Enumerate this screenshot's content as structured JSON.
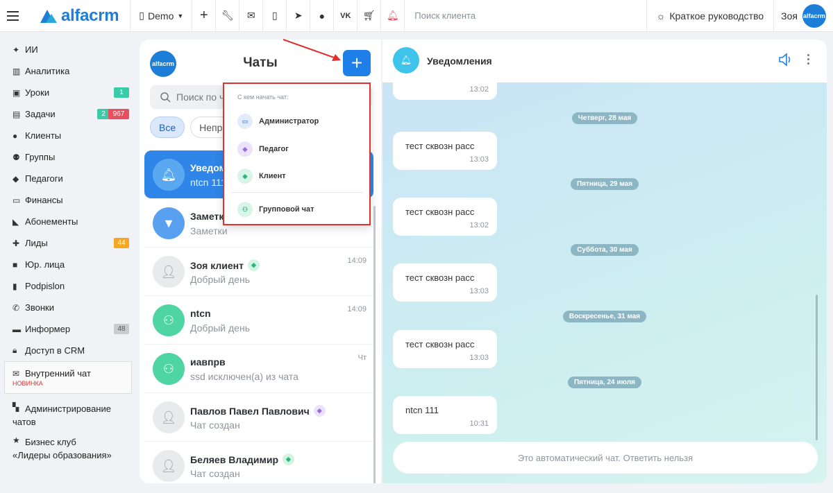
{
  "topbar": {
    "brand": "alfacrm",
    "demo_label": "Demo",
    "search_placeholder": "Поиск клиента",
    "guide_label": "Краткое руководство",
    "user_name": "Зоя",
    "avatar_text": "alfacrm"
  },
  "sidebar": {
    "items": [
      {
        "label": "ИИ",
        "icon": "sparkle-icon"
      },
      {
        "label": "Аналитика",
        "icon": "map-icon"
      },
      {
        "label": "Уроки",
        "icon": "calendar-icon",
        "badge": "1"
      },
      {
        "label": "Задачи",
        "icon": "clipboard-icon",
        "badge": "2",
        "badge2": "967"
      },
      {
        "label": "Клиенты",
        "icon": "person-icon"
      },
      {
        "label": "Группы",
        "icon": "group-icon"
      },
      {
        "label": "Педагоги",
        "icon": "graduation-cap-icon"
      },
      {
        "label": "Финансы",
        "icon": "money-icon"
      },
      {
        "label": "Абонементы",
        "icon": "tag-icon"
      },
      {
        "label": "Лиды",
        "icon": "add-person-icon",
        "badge": "44"
      },
      {
        "label": "Юр. лица",
        "icon": "briefcase-icon"
      },
      {
        "label": "Podpislon",
        "icon": "document-icon"
      },
      {
        "label": "Звонки",
        "icon": "phone-icon"
      },
      {
        "label": "Информер",
        "icon": "bulletin-icon",
        "badge": "48"
      },
      {
        "label": "Доступ в CRM",
        "icon": "lock-icon"
      },
      {
        "label": "Внутренний чат",
        "icon": "mail-icon",
        "note": "НОВИНКА"
      },
      {
        "label": "Администрирование чатов",
        "line1": "Администрирование",
        "line2": "чатов",
        "icon": "chat-admin-icon"
      },
      {
        "label": "Бизнес клуб «Лидеры образования»",
        "line1": "Бизнес клуб",
        "line2": "«Лидеры образования»",
        "icon": "star-icon"
      }
    ]
  },
  "chats": {
    "title": "Чаты",
    "logo_text": "alfacrm",
    "search_placeholder": "Поиск по ч",
    "filters": [
      "Все",
      "Непро"
    ],
    "items": [
      {
        "name": "Уведом",
        "message": "ntcn 111",
        "time": ""
      },
      {
        "name": "Заметк",
        "message": "Заметки",
        "time": ""
      },
      {
        "name": "Зоя клиент",
        "message": "Добрый день",
        "time": "14:09"
      },
      {
        "name": "ntcn",
        "message": "Добрый день",
        "time": "14:09"
      },
      {
        "name": "иавпрв",
        "message": "ssd исключен(а) из чата",
        "time": "Чт"
      },
      {
        "name": "Павлов Павел Павлович",
        "message": "Чат создан",
        "time": ""
      },
      {
        "name": "Беляев Владимир",
        "message": "Чат создан",
        "time": ""
      }
    ]
  },
  "popup": {
    "header": "С кем начать чат:",
    "options": [
      "Администратор",
      "Педагог",
      "Клиент",
      "Групповой чат"
    ],
    "border_color": "#e03131"
  },
  "conversation": {
    "title": "Уведомления",
    "first_time": "13:02",
    "blocks": [
      {
        "date": "Четверг, 28 мая",
        "text": "тест сквозн расс",
        "time": "13:03"
      },
      {
        "date": "Пятница, 29 мая",
        "text": "тест сквозн расс",
        "time": "13:02"
      },
      {
        "date": "Суббота, 30 мая",
        "text": "тест сквозн расс",
        "time": "13:03"
      },
      {
        "date": "Воскресенье, 31 мая",
        "text": "тест сквозн расс",
        "time": "13:03"
      },
      {
        "date": "Пятница, 24 июля",
        "text": "ntcn 111",
        "time": "10:31"
      }
    ],
    "auto_notice": "Это автоматический чат. Ответить нельзя"
  },
  "colors": {
    "accent": "#1f7fe8",
    "annotation": "#e03131"
  }
}
